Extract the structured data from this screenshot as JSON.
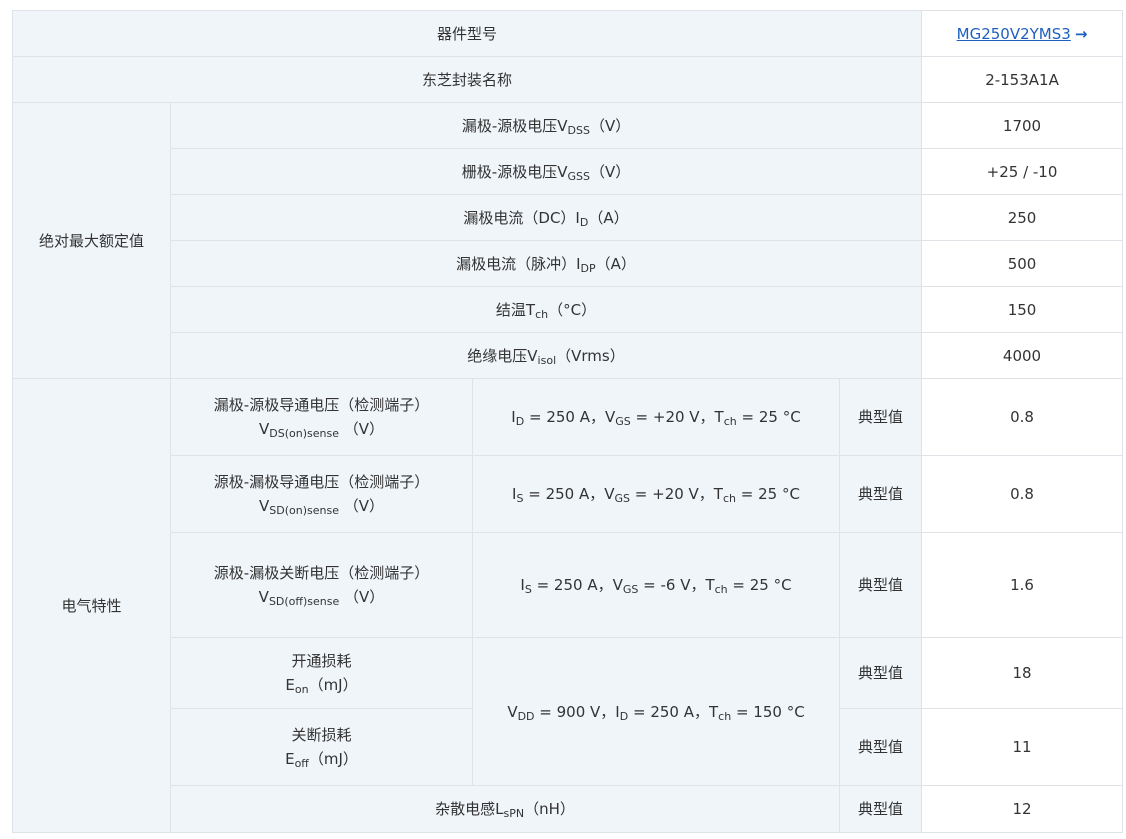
{
  "header": {
    "part_label": "器件型号",
    "part_value": "MG250V2YMS3",
    "package_label": "东芝封装名称",
    "package_value": "2-153A1A"
  },
  "abs_max": {
    "group_label": "绝对最大额定值",
    "rows": [
      {
        "label_pre": "漏极-源极电压V",
        "sub": "DSS",
        "label_post": "（V）",
        "value": "1700"
      },
      {
        "label_pre": "栅极-源极电压V",
        "sub": "GSS",
        "label_post": "（V）",
        "value": "+25 / -10"
      },
      {
        "label_pre": "漏极电流（DC）I",
        "sub": "D",
        "label_post": "（A）",
        "value": "250"
      },
      {
        "label_pre": "漏极电流（脉冲）I",
        "sub": "DP",
        "label_post": "（A）",
        "value": "500"
      },
      {
        "label_pre": "结温T",
        "sub": "ch",
        "label_post": "（°C）",
        "value": "150"
      },
      {
        "label_pre": "绝缘电压V",
        "sub": "isol",
        "label_post": "（Vrms）",
        "value": "4000"
      }
    ]
  },
  "electrical": {
    "group_label": "电气特性",
    "typ_label": "典型值",
    "rows": [
      {
        "line1": "漏极-源极导通电压（检测端子）",
        "sym": "V",
        "sym_sub": "DS(on)sense",
        "unit": "（V）",
        "cond": [
          {
            "t": "I"
          },
          {
            "s": "D"
          },
          {
            "t": " = 250 A，V"
          },
          {
            "s": "GS"
          },
          {
            "t": " = +20 V，T"
          },
          {
            "s": "ch"
          },
          {
            "t": " = 25 °C"
          }
        ],
        "value": "0.8"
      },
      {
        "line1": "源极-漏极导通电压（检测端子）",
        "sym": "V",
        "sym_sub": "SD(on)sense",
        "unit": "（V）",
        "cond": [
          {
            "t": "I"
          },
          {
            "s": "S"
          },
          {
            "t": " = 250 A，V"
          },
          {
            "s": "GS"
          },
          {
            "t": " = +20 V，T"
          },
          {
            "s": "ch"
          },
          {
            "t": " = 25 °C"
          }
        ],
        "value": "0.8"
      },
      {
        "line1": "源极-漏极关断电压（检测端子）",
        "sym": "V",
        "sym_sub": "SD(off)sense",
        "unit": "（V）",
        "cond": [
          {
            "t": "I"
          },
          {
            "s": "S"
          },
          {
            "t": " = 250 A，V"
          },
          {
            "s": "GS"
          },
          {
            "t": " = -6 V，T"
          },
          {
            "s": "ch"
          },
          {
            "t": " = 25 °C"
          }
        ],
        "value": "1.6"
      },
      {
        "line1": "开通损耗",
        "sym": "E",
        "sym_sub": "on",
        "unit": "（mJ）",
        "value": "18"
      },
      {
        "line1": "关断损耗",
        "sym": "E",
        "sym_sub": "off",
        "unit": "（mJ）",
        "value": "11"
      }
    ],
    "switching_cond": [
      {
        "t": "V"
      },
      {
        "s": "DD"
      },
      {
        "t": " = 900 V，I"
      },
      {
        "s": "D"
      },
      {
        "t": " = 250 A，T"
      },
      {
        "s": "ch"
      },
      {
        "t": " = 150 °C"
      }
    ],
    "stray": {
      "label_pre": "杂散电感L",
      "sub": "sPN",
      "label_post": "（nH）",
      "value": "12"
    }
  }
}
